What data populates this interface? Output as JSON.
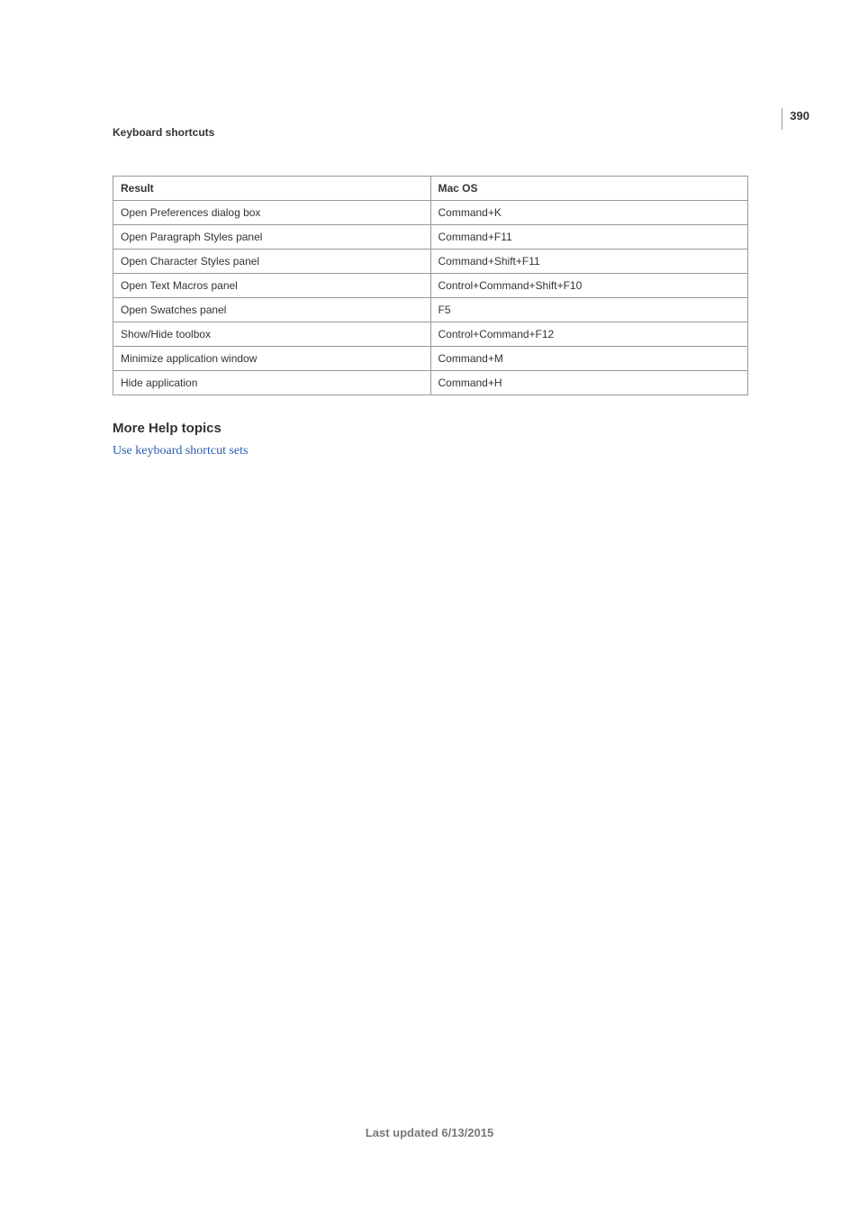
{
  "page_number": "390",
  "section_title": "Keyboard shortcuts",
  "table": {
    "headers": {
      "result": "Result",
      "macos": "Mac OS"
    },
    "rows": [
      {
        "result": "Open Preferences dialog box",
        "macos": "Command+K"
      },
      {
        "result": "Open Paragraph Styles panel",
        "macos": "Command+F11"
      },
      {
        "result": "Open Character Styles panel",
        "macos": "Command+Shift+F11"
      },
      {
        "result": "Open Text Macros panel",
        "macos": "Control+Command+Shift+F10"
      },
      {
        "result": "Open Swatches panel",
        "macos": "F5"
      },
      {
        "result": "Show/Hide toolbox",
        "macos": "Control+Command+F12"
      },
      {
        "result": "Minimize application window",
        "macos": "Command+M"
      },
      {
        "result": "Hide application",
        "macos": "Command+H"
      }
    ]
  },
  "more_help": {
    "heading": "More Help topics",
    "link": "Use keyboard shortcut sets"
  },
  "footer": "Last updated 6/13/2015"
}
